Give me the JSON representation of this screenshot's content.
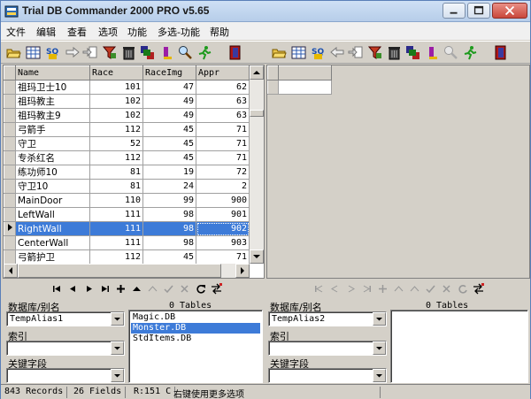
{
  "window": {
    "title": "Trial DB Commander 2000 PRO v5.65"
  },
  "menu": [
    "文件",
    "编辑",
    "查看",
    "选项",
    "功能",
    "多选-功能",
    "帮助"
  ],
  "left_grid": {
    "columns": [
      "Name",
      "Race",
      "RaceImg",
      "Appr"
    ],
    "rows": [
      {
        "name": "祖玛卫士10",
        "race": "101",
        "raceimg": "47",
        "appr": "62"
      },
      {
        "name": "祖玛教主",
        "race": "102",
        "raceimg": "49",
        "appr": "63"
      },
      {
        "name": "祖玛教主9",
        "race": "102",
        "raceimg": "49",
        "appr": "63"
      },
      {
        "name": "弓箭手",
        "race": "112",
        "raceimg": "45",
        "appr": "71"
      },
      {
        "name": "守卫",
        "race": "52",
        "raceimg": "45",
        "appr": "71"
      },
      {
        "name": "专杀红名",
        "race": "112",
        "raceimg": "45",
        "appr": "71"
      },
      {
        "name": "练功师10",
        "race": "81",
        "raceimg": "19",
        "appr": "72"
      },
      {
        "name": "守卫10",
        "race": "81",
        "raceimg": "24",
        "appr": "2"
      },
      {
        "name": "MainDoor",
        "race": "110",
        "raceimg": "99",
        "appr": "900"
      },
      {
        "name": "LeftWall",
        "race": "111",
        "raceimg": "98",
        "appr": "901"
      },
      {
        "name": "RightWall",
        "race": "111",
        "raceimg": "98",
        "appr": "902"
      },
      {
        "name": "CenterWall",
        "race": "111",
        "raceimg": "98",
        "appr": "903"
      },
      {
        "name": "弓箭护卫",
        "race": "112",
        "raceimg": "45",
        "appr": "71"
      }
    ],
    "selected_index": 10
  },
  "left_panel": {
    "db_label": "数据库/别名",
    "alias_value": "TempAlias1",
    "index_label": "索引",
    "index_value": "",
    "key_label": "关键字段",
    "key_value": "",
    "tables_count": "0 Tables",
    "tables": [
      "Magic.DB",
      "Monster.DB",
      "StdItems.DB"
    ],
    "selected_table": 1
  },
  "right_panel": {
    "db_label": "数据库/别名",
    "alias_value": "TempAlias2",
    "index_label": "索引",
    "index_value": "",
    "key_label": "关键字段",
    "key_value": "",
    "tables_count": "0 Tables"
  },
  "status": {
    "records": "843 Records",
    "fields": "26 Fields",
    "position": "R:151 C",
    "hint": "右键使用更多选项"
  }
}
